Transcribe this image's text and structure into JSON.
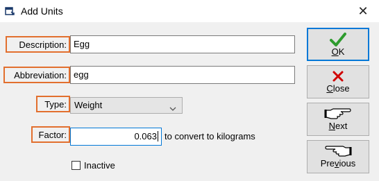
{
  "window": {
    "title": "Add Units",
    "close_glyph": "✕"
  },
  "form": {
    "description": {
      "label": "Description:",
      "value": "Egg"
    },
    "abbreviation": {
      "label": "Abbreviation:",
      "value": "egg"
    },
    "type": {
      "label": "Type:",
      "selected": "Weight"
    },
    "factor": {
      "label": "Factor:",
      "value": "0.063",
      "hint": "to convert to kilograms"
    },
    "inactive": {
      "label": "Inactive",
      "checked": false
    }
  },
  "buttons": {
    "ok": {
      "first": "O",
      "rest": "K",
      "icon": "checkmark-icon",
      "color": "#2e9b2e"
    },
    "close": {
      "first": "C",
      "rest": "lose",
      "icon": "red-x-icon",
      "color": "#d00000"
    },
    "next": {
      "first": "N",
      "rest": "ext",
      "icon": "pointing-hand-right-icon"
    },
    "previous": {
      "pre": "Pre",
      "mid": "v",
      "rest": "ious",
      "icon": "pointing-hand-left-icon"
    }
  },
  "colors": {
    "label_border": "#e26f2e",
    "focus_border": "#0078d7"
  }
}
